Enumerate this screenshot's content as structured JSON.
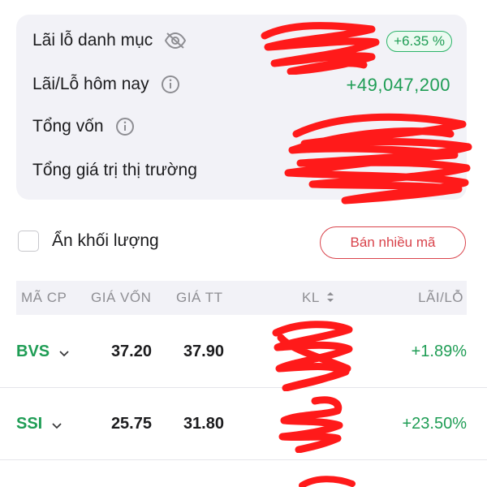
{
  "summary": {
    "portfolio_pnl_label": "Lãi lỗ danh mục",
    "portfolio_pnl_pct": "+6.35 %",
    "today_pnl_label": "Lãi/Lỗ hôm nay",
    "today_pnl_value": "+49,047,200",
    "total_capital_label": "Tổng vốn",
    "market_value_label": "Tổng giá trị thị trường"
  },
  "controls": {
    "hide_volume_label": "Ẩn khối lượng",
    "sell_multiple_label": "Bán nhiều mã"
  },
  "table": {
    "headers": {
      "ticker": "MÃ CP",
      "cost_price": "GIÁ VỐN",
      "market_price": "GIÁ TT",
      "volume": "KL",
      "pnl": "LÃI/LỖ"
    },
    "rows": [
      {
        "ticker": "BVS",
        "cost_price": "37.20",
        "market_price": "37.90",
        "pnl": "+1.89%"
      },
      {
        "ticker": "SSI",
        "cost_price": "25.75",
        "market_price": "31.80",
        "pnl": "+23.50%"
      }
    ]
  },
  "colors": {
    "positive": "#1f9d55",
    "sell_accent": "#d9434b",
    "redaction": "#ff1a1a"
  },
  "icons": [
    "eye-off-icon",
    "info-icon",
    "sort-icon",
    "chevron-down-icon"
  ]
}
